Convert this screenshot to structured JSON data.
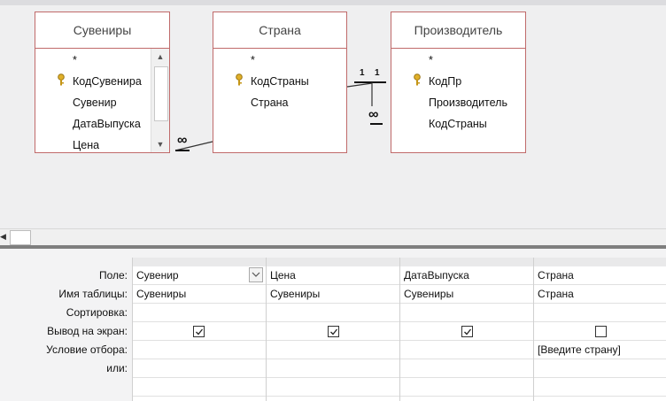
{
  "relationship_tables": [
    {
      "title": "Сувениры",
      "fields": [
        {
          "name": "*",
          "key": false
        },
        {
          "name": "КодСувенира",
          "key": true
        },
        {
          "name": "Сувенир",
          "key": false
        },
        {
          "name": "ДатаВыпуска",
          "key": false
        },
        {
          "name": "Цена",
          "key": false
        }
      ]
    },
    {
      "title": "Страна",
      "fields": [
        {
          "name": "*",
          "key": false
        },
        {
          "name": "КодСтраны",
          "key": true
        },
        {
          "name": "Страна",
          "key": false
        }
      ]
    },
    {
      "title": "Производитель",
      "fields": [
        {
          "name": "*",
          "key": false
        },
        {
          "name": "КодПр",
          "key": true
        },
        {
          "name": "Производитель",
          "key": false
        },
        {
          "name": "КодСтраны",
          "key": false
        }
      ]
    }
  ],
  "join_labels": {
    "infinity": "∞",
    "one": "1"
  },
  "scroll_glyphs": {
    "up": "▲",
    "down": "▼",
    "left": "◀"
  },
  "grid": {
    "row_labels": [
      "Поле:",
      "Имя таблицы:",
      "Сортировка:",
      "Вывод на экран:",
      "Условие отбора:",
      "или:"
    ],
    "columns": [
      {
        "field": "Сувенир",
        "table": "Сувениры",
        "sort": "",
        "show": true,
        "criteria": "",
        "or": ""
      },
      {
        "field": "Цена",
        "table": "Сувениры",
        "sort": "",
        "show": true,
        "criteria": "",
        "or": ""
      },
      {
        "field": "ДатаВыпуска",
        "table": "Сувениры",
        "sort": "",
        "show": true,
        "criteria": "",
        "or": ""
      },
      {
        "field": "Страна",
        "table": "Страна",
        "sort": "",
        "show": false,
        "criteria": "[Введите страну]",
        "or": ""
      }
    ]
  },
  "colors": {
    "table_border": "#c06a6a",
    "splitter": "#7f7f7f"
  }
}
